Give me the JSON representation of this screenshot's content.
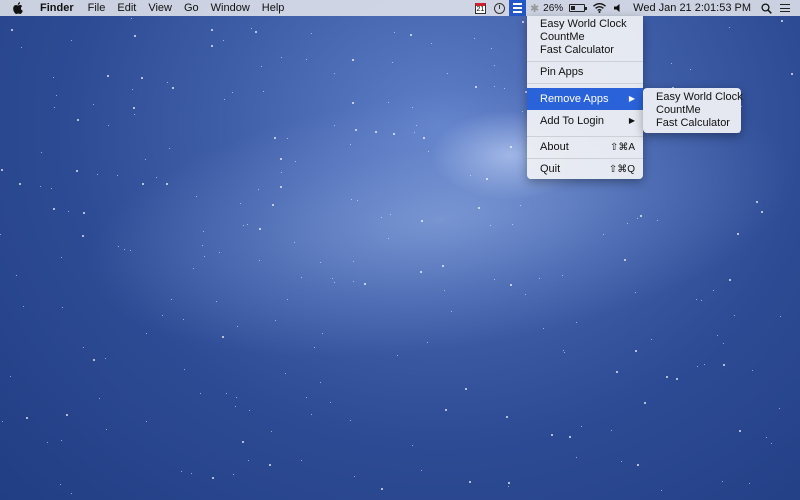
{
  "menubar": {
    "app_name": "Finder",
    "menus": [
      "File",
      "Edit",
      "View",
      "Go",
      "Window",
      "Help"
    ],
    "calendar_day": "21",
    "battery": "26%",
    "datetime": "Wed Jan 21  2:01:53 PM",
    "status_icons": [
      "calendar-icon",
      "clock-icon",
      "menu-app-icon",
      "bluetooth-icon",
      "battery-icon",
      "wifi-icon",
      "volume-icon",
      "spotlight-icon",
      "notification-center-icon"
    ]
  },
  "dropdown": {
    "apps": [
      "Easy World Clock",
      "CountMe",
      "Fast Calculator"
    ],
    "pin_apps": "Pin Apps",
    "remove_apps": "Remove Apps",
    "add_to_login": "Add To Login",
    "about": "About",
    "about_shortcut": "⇧⌘A",
    "quit": "Quit",
    "quit_shortcut": "⇧⌘Q",
    "highlight_color": "#2a63d9"
  },
  "submenu": {
    "apps": [
      "Easy World Clock",
      "CountMe",
      "Fast Calculator"
    ]
  }
}
